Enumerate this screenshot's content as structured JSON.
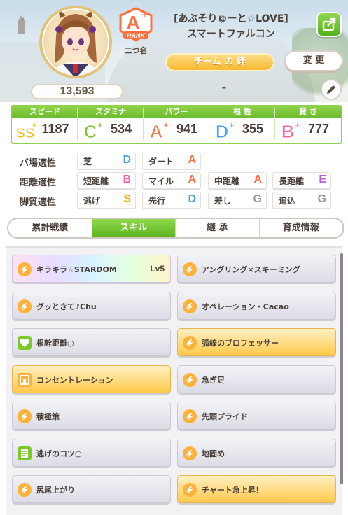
{
  "profile": {
    "score": "13,593",
    "rank_grade": "A",
    "rank_label": "RANK",
    "nickname": "二つ名",
    "trainer_name": "[あぶそりゅーと☆LOVE]",
    "horse_name": "スマートファルコン",
    "team_banner": "チーム の 絆",
    "team_value": "-",
    "change_label": "変 更"
  },
  "stats": [
    {
      "label": "スピード",
      "grade": "SS",
      "value": "1187",
      "color": "#f7b100"
    },
    {
      "label": "スタミナ",
      "grade": "C",
      "value": "534",
      "color": "#7bc92a"
    },
    {
      "label": "パワー",
      "grade": "A",
      "value": "941",
      "color": "#ff6f3c"
    },
    {
      "label": "根 性",
      "grade": "D",
      "value": "355",
      "color": "#4aa3f0"
    },
    {
      "label": "賢 さ",
      "grade": "B",
      "value": "777",
      "color": "#ff5fa5"
    }
  ],
  "aptitude": {
    "rows": [
      {
        "label": "バ場適性",
        "items": [
          {
            "name": "芝",
            "grade": "D"
          },
          {
            "name": "ダート",
            "grade": "A"
          }
        ]
      },
      {
        "label": "距離適性",
        "items": [
          {
            "name": "短距離",
            "grade": "B"
          },
          {
            "name": "マイル",
            "grade": "A"
          },
          {
            "name": "中距離",
            "grade": "A"
          },
          {
            "name": "長距離",
            "grade": "E"
          }
        ]
      },
      {
        "label": "脚質適性",
        "items": [
          {
            "name": "逃げ",
            "grade": "S"
          },
          {
            "name": "先行",
            "grade": "D"
          },
          {
            "name": "差し",
            "grade": "G"
          },
          {
            "name": "追込",
            "grade": "G"
          }
        ]
      }
    ],
    "grade_colors": {
      "S": "#f7b100",
      "A": "#ff6f3c",
      "B": "#ff5fa5",
      "C": "#7bc92a",
      "D": "#4aa3f0",
      "E": "#b45fe0",
      "G": "#9a9a9a"
    }
  },
  "tabs": [
    {
      "label": "累計戦績",
      "active": false
    },
    {
      "label": "スキル",
      "active": true
    },
    {
      "label": "継 承",
      "active": false
    },
    {
      "label": "育成情報",
      "active": false
    }
  ],
  "skills": [
    {
      "name": "キラキラ☆STARDOM",
      "level": "Lv5",
      "style": "rainbow",
      "icon": "speed-icon"
    },
    {
      "name": "アングリング×スキーミング",
      "level": "",
      "style": "gray",
      "icon": "speed-icon"
    },
    {
      "name": "グッときて♪Chu",
      "level": "",
      "style": "gray",
      "icon": "speed-icon"
    },
    {
      "name": "オペレーション・Cacao",
      "level": "",
      "style": "gray",
      "icon": "speed-icon"
    },
    {
      "name": "根幹距離○",
      "level": "",
      "style": "gray",
      "icon": "heart-icon"
    },
    {
      "name": "弧線のプロフェッサー",
      "level": "",
      "style": "gold",
      "icon": "speed-icon"
    },
    {
      "name": "コンセントレーション",
      "level": "",
      "style": "gold",
      "icon": "gate-icon"
    },
    {
      "name": "急ぎ足",
      "level": "",
      "style": "gray",
      "icon": "speed-icon"
    },
    {
      "name": "積極策",
      "level": "",
      "style": "gray",
      "icon": "speed-icon"
    },
    {
      "name": "先頭プライド",
      "level": "",
      "style": "gray",
      "icon": "speed-icon"
    },
    {
      "name": "逃げのコツ○",
      "level": "",
      "style": "gray",
      "icon": "book-icon"
    },
    {
      "name": "地固め",
      "level": "",
      "style": "gray",
      "icon": "speed-icon"
    },
    {
      "name": "尻尾上がり",
      "level": "",
      "style": "gray",
      "icon": "speed-icon"
    },
    {
      "name": "チャート急上昇！",
      "level": "",
      "style": "gold",
      "icon": "speed-icon"
    }
  ]
}
